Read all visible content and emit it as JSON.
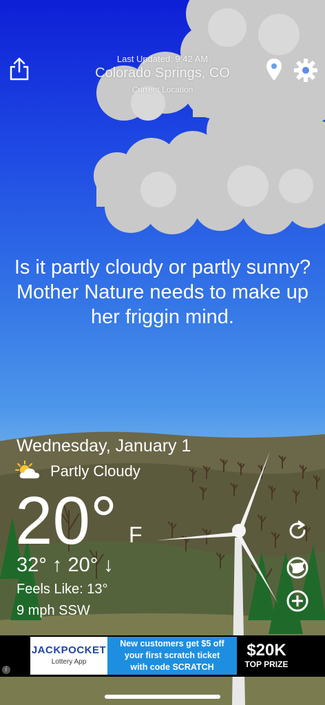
{
  "header": {
    "last_updated": "Last Updated: 9:42 AM",
    "location": "Colorado Springs, CO",
    "location_sub": "Current Location",
    "share_icon": "share-icon",
    "pin_icon": "location-pin-icon",
    "settings_icon": "gear-icon"
  },
  "quote": "Is it partly cloudy or partly sunny? Mother Nature needs to make up her friggin mind.",
  "weather": {
    "date": "Wednesday, January 1",
    "condition": "Partly Cloudy",
    "condition_icon": "partly-cloudy-icon",
    "temperature": "20°",
    "unit": "F",
    "high_low": "32° ↑ 20° ↓",
    "feels_like": "Feels Like: 13°",
    "wind": "9 mph SSW"
  },
  "side_buttons": {
    "refresh_icon": "refresh-icon",
    "radar_icon": "radar-icon",
    "add_icon": "add-icon"
  },
  "ad": {
    "brand": "JACKPOCKET",
    "brand_sub": "Lottery App",
    "line1": "New customers get $5 off",
    "line2": "your first scratch ticket",
    "line3": "with code SCRATCH",
    "prize_amount": "$20K",
    "prize_label": "TOP PRIZE",
    "info_icon": "info-icon"
  },
  "colors": {
    "sky_top": "#0e1fd6",
    "sky_bottom": "#73b2ea",
    "ground": "#5a5a3c",
    "ad_accent": "#1e8fe0"
  }
}
